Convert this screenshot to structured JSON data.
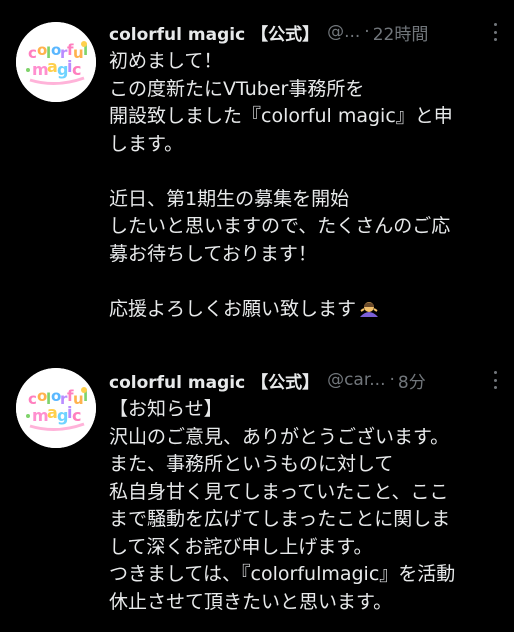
{
  "tweets": [
    {
      "name": "colorful magic 【公式】",
      "handle": "@...",
      "time": "22時間",
      "avatar_text": "colorful magic",
      "lines": [
        "初めまして！",
        "この度新たにVTuber事務所を",
        "開設致しました『colorful magic』と申",
        "します。",
        "",
        "近日、第1期生の募集を開始",
        "したいと思いますので、たくさんのご応",
        "募お待ちしております！",
        "",
        "応援よろしくお願い致します"
      ],
      "emoji": "person-bowing-emoji"
    },
    {
      "name": "colorful magic 【公式】",
      "handle": "@car...",
      "time": "8分",
      "avatar_text": "colorful magic",
      "lines": [
        "【お知らせ】",
        "沢山のご意見、ありがとうございます。",
        "また、事務所というものに対して",
        "私自身甘く見てしまっていたこと、ここ",
        "まで騒動を広げてしまったことに関しま",
        "して深くお詫び申し上げます。",
        "つきましては、『colorfulmagic』を活動",
        "休止させて頂きたいと思います。"
      ]
    }
  ]
}
